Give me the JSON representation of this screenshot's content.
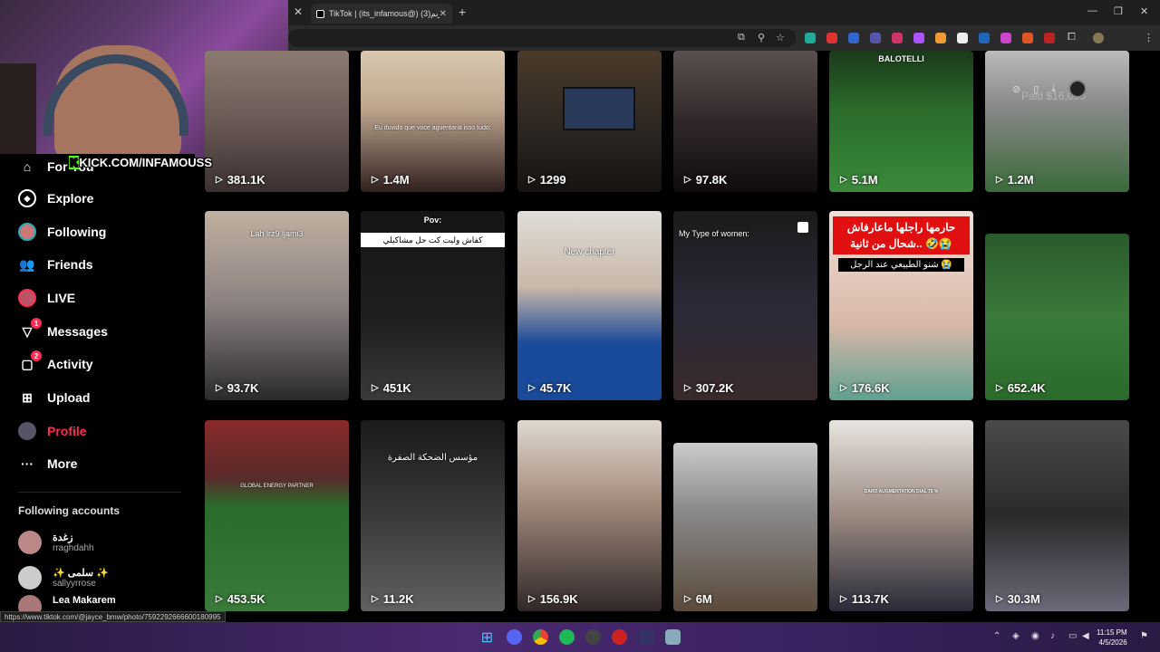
{
  "browser": {
    "tab_title": "TikTok | (its_infamous@) گريم(3)",
    "tab_close": "✕",
    "new_tab": "+",
    "window_controls": [
      "—",
      "❐",
      "✕"
    ],
    "status_url": "https://www.tiktok.com/@jayce_bmw/photo/7592292666600180995"
  },
  "stream": {
    "kick_prefix": "K",
    "kick_text": "KICK.COM/INFAMOUSS"
  },
  "sidebar": {
    "items": [
      {
        "label": "For You",
        "icon": "home-icon"
      },
      {
        "label": "Explore",
        "icon": "compass-icon"
      },
      {
        "label": "Following",
        "icon": "following-avatar"
      },
      {
        "label": "Friends",
        "icon": "friends-icon"
      },
      {
        "label": "LIVE",
        "icon": "live-avatar"
      },
      {
        "label": "Messages",
        "icon": "messages-icon",
        "badge": "1"
      },
      {
        "label": "Activity",
        "icon": "activity-icon",
        "badge": "2"
      },
      {
        "label": "Upload",
        "icon": "upload-icon"
      },
      {
        "label": "Profile",
        "icon": "profile-avatar"
      },
      {
        "label": "More",
        "icon": "more-icon"
      }
    ],
    "following_title": "Following accounts",
    "accounts": [
      {
        "name": "زغدة",
        "username": "rraghdahh"
      },
      {
        "name": "✨ سلمى ✨",
        "username": "sallyyrrose"
      },
      {
        "name": "Lea Makarem",
        "username": ""
      }
    ]
  },
  "overlay": {
    "paid_text": "Paid $16,000",
    "icons": [
      "link-icon",
      "phone-icon",
      "download-icon",
      "disc-icon"
    ]
  },
  "videos": [
    {
      "views": "381.1K",
      "caption": ""
    },
    {
      "views": "1.4M",
      "caption": "Eu duvido que voce aguentaria isso tudo:"
    },
    {
      "views": "1299",
      "caption": ""
    },
    {
      "views": "97.8K",
      "caption": ""
    },
    {
      "views": "5.1M",
      "caption": "BALOTELLI"
    },
    {
      "views": "1.2M",
      "caption": ""
    },
    {
      "views": "93.7K",
      "caption": "Lah lrz9 ljami3"
    },
    {
      "views": "451K",
      "caption": "Pov:",
      "caption2": "كفاش وليت كت حل مشاكيلي"
    },
    {
      "views": "45.7K",
      "caption": "New chapter"
    },
    {
      "views": "307.2K",
      "caption": "My Type of women:"
    },
    {
      "views": "176.6K",
      "caption": "حارمها راجلها ماعارفاش شحال من ثانية.. 🤣😭",
      "caption2": "شنو الطبيعي عند الرجل 😭"
    },
    {
      "views": "652.4K",
      "caption": ""
    },
    {
      "views": "453.5K",
      "caption": "GLOBAL ENERGY PARTNER"
    },
    {
      "views": "11.2K",
      "caption": "مؤسس الضحكة الصفرة"
    },
    {
      "views": "156.9K",
      "caption": ""
    },
    {
      "views": "6M",
      "caption": ""
    },
    {
      "views": "113.7K",
      "caption": "DARO AUGMENTATION DIAL 75 %"
    },
    {
      "views": "30.3M",
      "caption": ""
    }
  ],
  "taskbar": {
    "time": "11:15 PM",
    "date": "4/5/2026"
  },
  "colors": {
    "accent": "#fe2c55",
    "kick_green": "#53fc18"
  }
}
